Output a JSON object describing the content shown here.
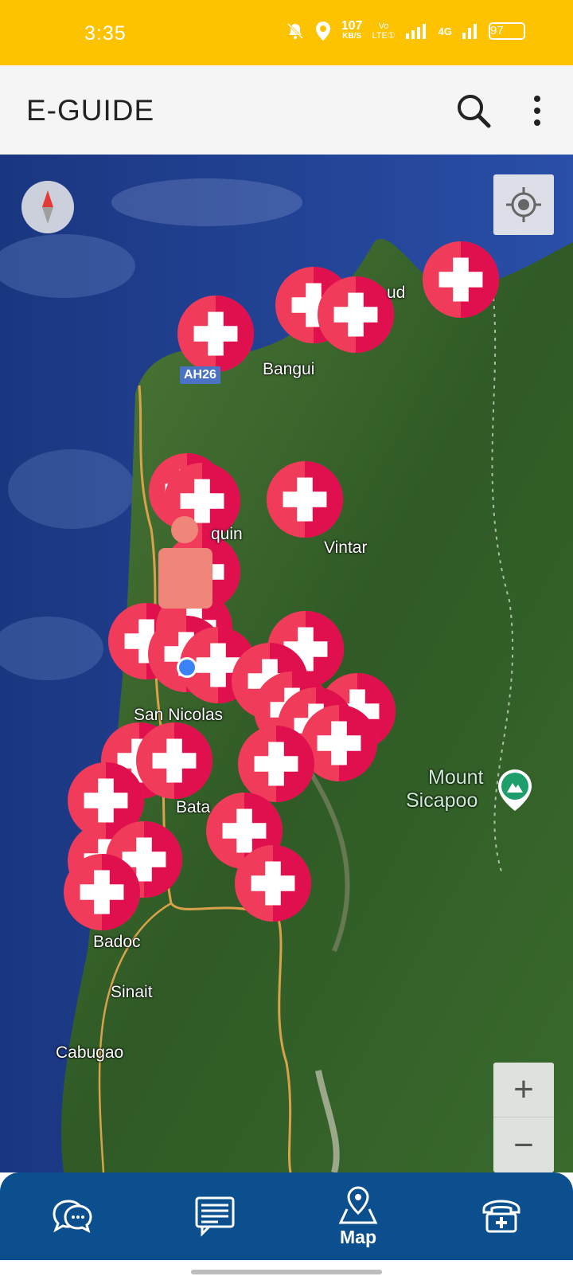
{
  "status_bar": {
    "time": "3:35",
    "net_speed_value": "107",
    "net_speed_unit": "KB/S",
    "volte_top": "Vo",
    "volte_bottom": "LTE①",
    "network": "4G",
    "battery": "97"
  },
  "app_bar": {
    "title": "E-GUIDE",
    "search_icon": "search-icon",
    "more_icon": "more-vert-icon"
  },
  "map": {
    "places": {
      "bangui": "Bangui",
      "pagudpud_fragment": "ud",
      "burgos_fragment": "quin",
      "vintar": "Vintar",
      "san_nicolas": "San Nicolas",
      "batac_fragment": "Bata",
      "badoc": "Badoc",
      "sinait": "Sinait",
      "cabugao": "Cabugao",
      "mount_line1": "Mount",
      "mount_line2": "Sicapoo"
    },
    "road_badge": "AH26",
    "zoom_in": "+",
    "zoom_out": "−",
    "colors": {
      "marker": "#f03c5a",
      "marker_dark": "#e0104e",
      "water": "#1e3a8c",
      "land": "#3d6b2f"
    }
  },
  "bottom_nav": {
    "items": [
      {
        "name": "chat",
        "icon": "chat-bubbles-icon"
      },
      {
        "name": "news",
        "icon": "message-list-icon"
      },
      {
        "name": "map",
        "icon": "map-pin-icon",
        "label": "Map",
        "active": true
      },
      {
        "name": "hotline",
        "icon": "medical-phone-icon"
      }
    ]
  }
}
